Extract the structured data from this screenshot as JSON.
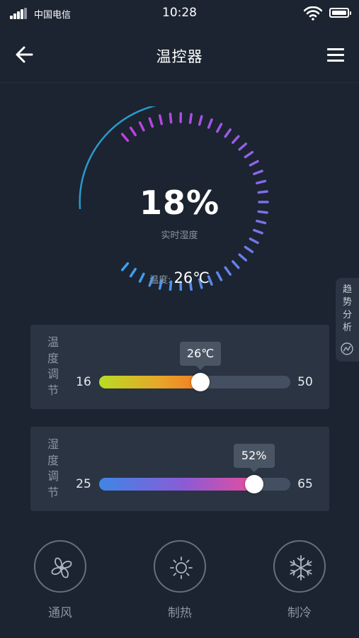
{
  "status_bar": {
    "carrier": "中国电信",
    "time": "10:28"
  },
  "nav": {
    "title": "温控器"
  },
  "gauge": {
    "value_text": "18%",
    "value_fraction": 0.18,
    "label": "实时湿度",
    "temp_label": "温度:",
    "temp_value": "26℃",
    "colors": {
      "start": "#3aa0f0",
      "end": "#c33de0",
      "track": "#2a9ac9"
    }
  },
  "trend_tab": {
    "label": "趋势分析"
  },
  "temp_panel": {
    "label": "温度调节",
    "min": "16",
    "max": "50",
    "value": "26℃",
    "fraction": 0.53
  },
  "humidity_panel": {
    "label": "湿度调节",
    "min": "25",
    "max": "65",
    "value": "52%",
    "fraction": 0.81
  },
  "modes": [
    {
      "label": "通风",
      "icon": "fan-icon"
    },
    {
      "label": "制热",
      "icon": "sun-icon"
    },
    {
      "label": "制冷",
      "icon": "snowflake-icon"
    }
  ]
}
